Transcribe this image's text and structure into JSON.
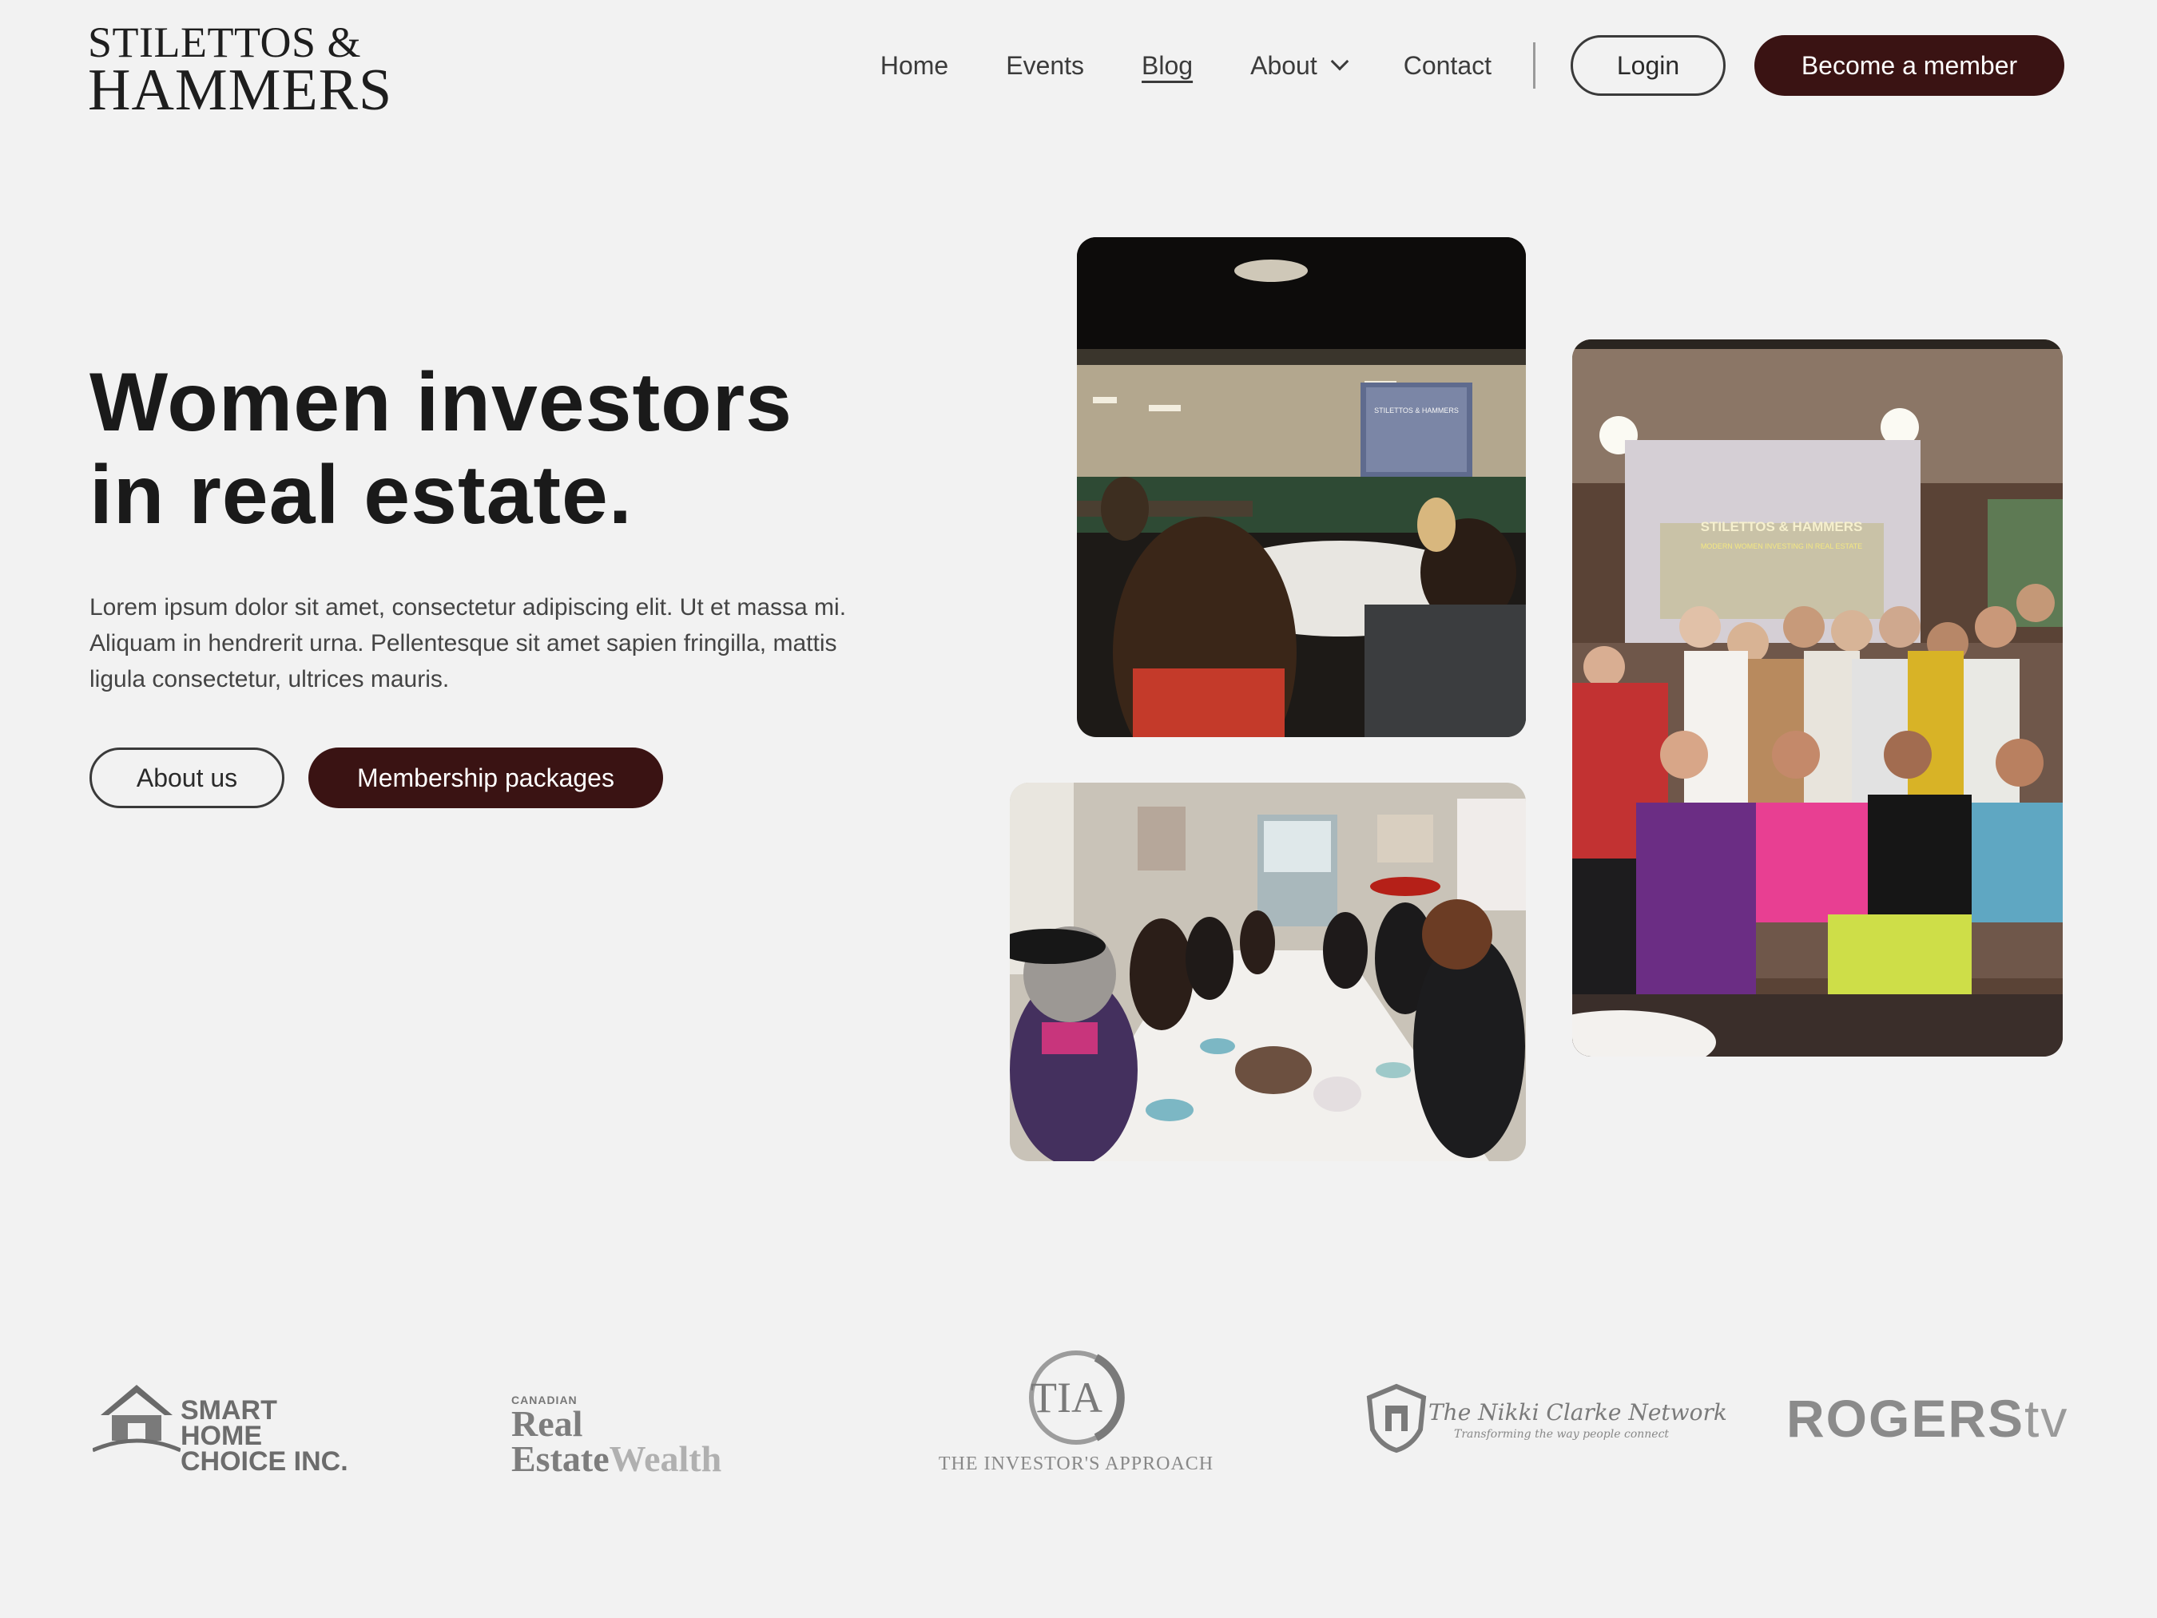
{
  "brand": {
    "line1": "STILETTOS &",
    "line2": "HAMMERS"
  },
  "nav": {
    "items": [
      {
        "label": "Home"
      },
      {
        "label": "Events"
      },
      {
        "label": "Blog"
      },
      {
        "label": "About"
      },
      {
        "label": "Contact"
      }
    ],
    "login_label": "Login",
    "member_label": "Become a member"
  },
  "hero": {
    "title_line1": "Women investors",
    "title_line2": "in real estate.",
    "description": "Lorem ipsum dolor sit amet, consectetur adipiscing elit. Ut et massa mi. Aliquam in hendrerit urna. Pellentesque sit amet sapien fringilla, mattis ligula consectetur, ultrices mauris.",
    "about_label": "About us",
    "packages_label": "Membership packages"
  },
  "photos": {
    "slide_title": "STILETTOS & HAMMERS",
    "slide_subtitle": "MODERN WOMEN INVESTING IN REAL ESTATE"
  },
  "partners": {
    "smart_home_line1": "SMART HOME",
    "smart_home_line2": "CHOICE INC.",
    "rew_small": "CANADIAN",
    "rew_real_estate": "Real Estate",
    "rew_wealth": "Wealth",
    "tia_mark": "TIA",
    "tia_text": "THE INVESTOR'S APPROACH",
    "nikki_title": "The Nikki Clarke Network",
    "nikki_tagline": "Transforming the way people connect",
    "rogers": "ROGERS",
    "rogers_tv": "tv"
  },
  "colors": {
    "background": "#f2f2f2",
    "accent": "#3a1313",
    "text": "#1a1a1a"
  }
}
